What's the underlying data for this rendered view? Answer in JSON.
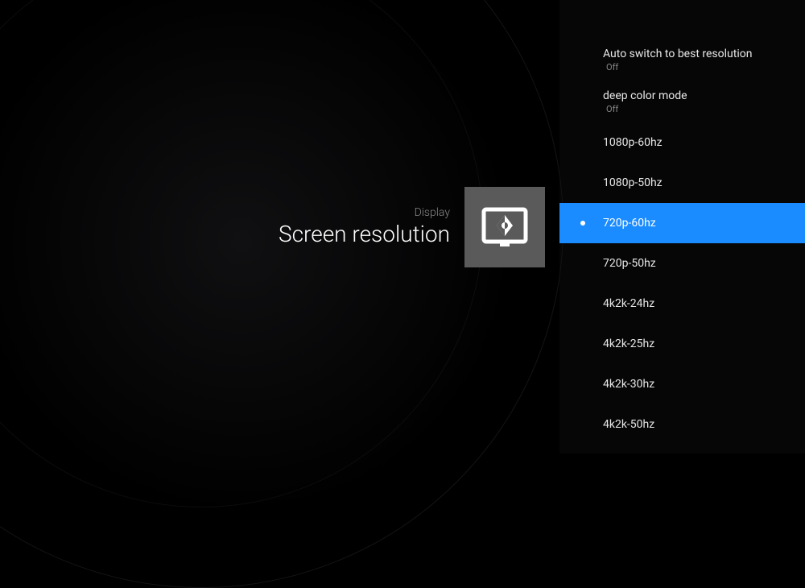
{
  "header": {
    "breadcrumb": "Display",
    "title": "Screen resolution"
  },
  "options": {
    "autoSwitch": {
      "label": "Auto switch to best resolution",
      "value": "Off"
    },
    "deepColor": {
      "label": "deep color mode",
      "value": "Off"
    },
    "res0": "1080p-60hz",
    "res1": "1080p-50hz",
    "res2": "720p-60hz",
    "res3": "720p-50hz",
    "res4": "4k2k-24hz",
    "res5": "4k2k-25hz",
    "res6": "4k2k-30hz",
    "res7": "4k2k-50hz"
  }
}
